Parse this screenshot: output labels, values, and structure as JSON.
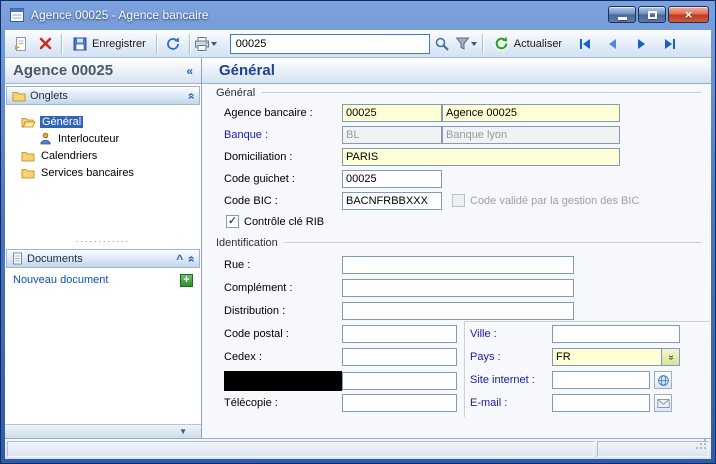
{
  "window": {
    "title": "Agence 00025  -  Agence bancaire"
  },
  "toolbar": {
    "save_label": "Enregistrer",
    "search_value": "00025",
    "refresh_label": "Actualiser"
  },
  "sidebar": {
    "title": "Agence 00025",
    "panels": {
      "onglets": "Onglets",
      "documents": "Documents"
    },
    "tree": [
      {
        "label": "Général"
      },
      {
        "label": "Interlocuteur"
      },
      {
        "label": "Calendriers"
      },
      {
        "label": "Services bancaires"
      }
    ],
    "new_document": "Nouveau document"
  },
  "main": {
    "header": "Général",
    "group_general": {
      "title": "Général",
      "agence_label": "Agence bancaire :",
      "agence_code": "00025",
      "agence_name": "Agence 00025",
      "banque_label": "Banque :",
      "banque_code": "BL",
      "banque_name": "Banque lyon",
      "domiciliation_label": "Domiciliation :",
      "domiciliation_value": "PARIS",
      "guichet_label": "Code guichet :",
      "guichet_value": "00025",
      "bic_label": "Code BIC :",
      "bic_value": "BACNFRBBXXX",
      "bic_check_label": "Code validé par la gestion des BIC",
      "rib_check_label": "Contrôle clé RIB"
    },
    "group_identification": {
      "title": "Identification",
      "rue_label": "Rue :",
      "complement_label": "Complément :",
      "distribution_label": "Distribution :",
      "code_postal_label": "Code postal :",
      "cedex_label": "Cedex :",
      "telecopie_label": "Télécopie :",
      "ville_label": "Ville :",
      "pays_label": "Pays :",
      "pays_value": "FR",
      "site_label": "Site internet :",
      "email_label": "E-mail :"
    }
  },
  "icons": {
    "collapse_left": "«",
    "collapse_up": "»",
    "chevron_up": "^",
    "scroll_down": "▼",
    "plus": "+",
    "dots": "............",
    "dropdown": "»",
    "check": "✓",
    "close": "×"
  }
}
